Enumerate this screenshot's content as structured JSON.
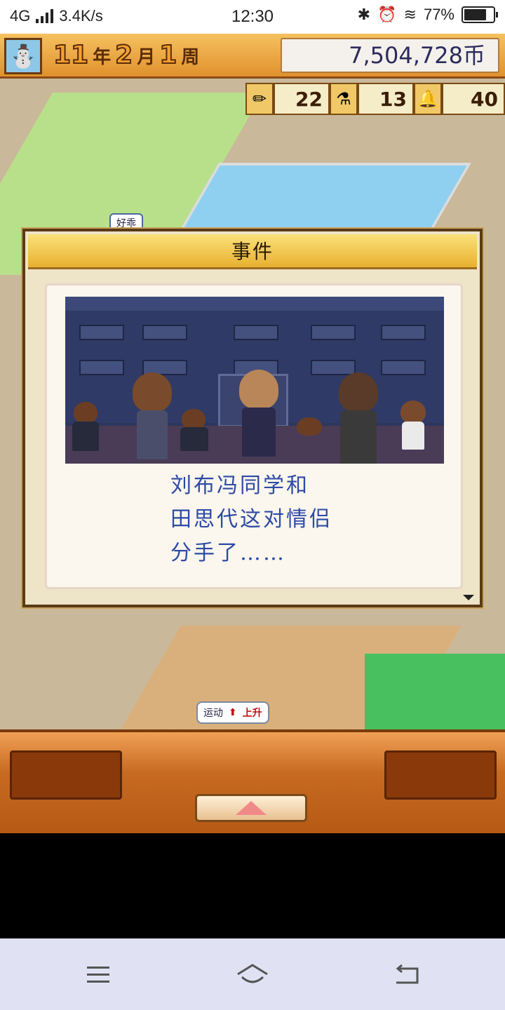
{
  "status_bar": {
    "network": "4G",
    "speed": "3.4K/s",
    "time": "12:30",
    "battery": "77%",
    "battery_level": 0.77
  },
  "hud": {
    "year": "11",
    "year_unit": "年",
    "month": "2",
    "month_unit": "月",
    "week": "1",
    "week_unit": "周",
    "money": "7,504,728币",
    "stats": [
      {
        "icon": "pencil-icon",
        "value": "22"
      },
      {
        "icon": "flask-icon",
        "value": "13"
      },
      {
        "icon": "bell-icon",
        "value": "40"
      }
    ]
  },
  "scene": {
    "sign_label": "好乖",
    "sport_label": "运动",
    "sport_up": "上升"
  },
  "event_dialog": {
    "title": "事件",
    "lines": [
      "刘布冯同学和",
      "田思代这对情侣",
      "分手了……"
    ]
  },
  "navbar": {
    "menu_icon": "menu-icon",
    "home_icon": "home-icon",
    "back_icon": "back-icon"
  }
}
